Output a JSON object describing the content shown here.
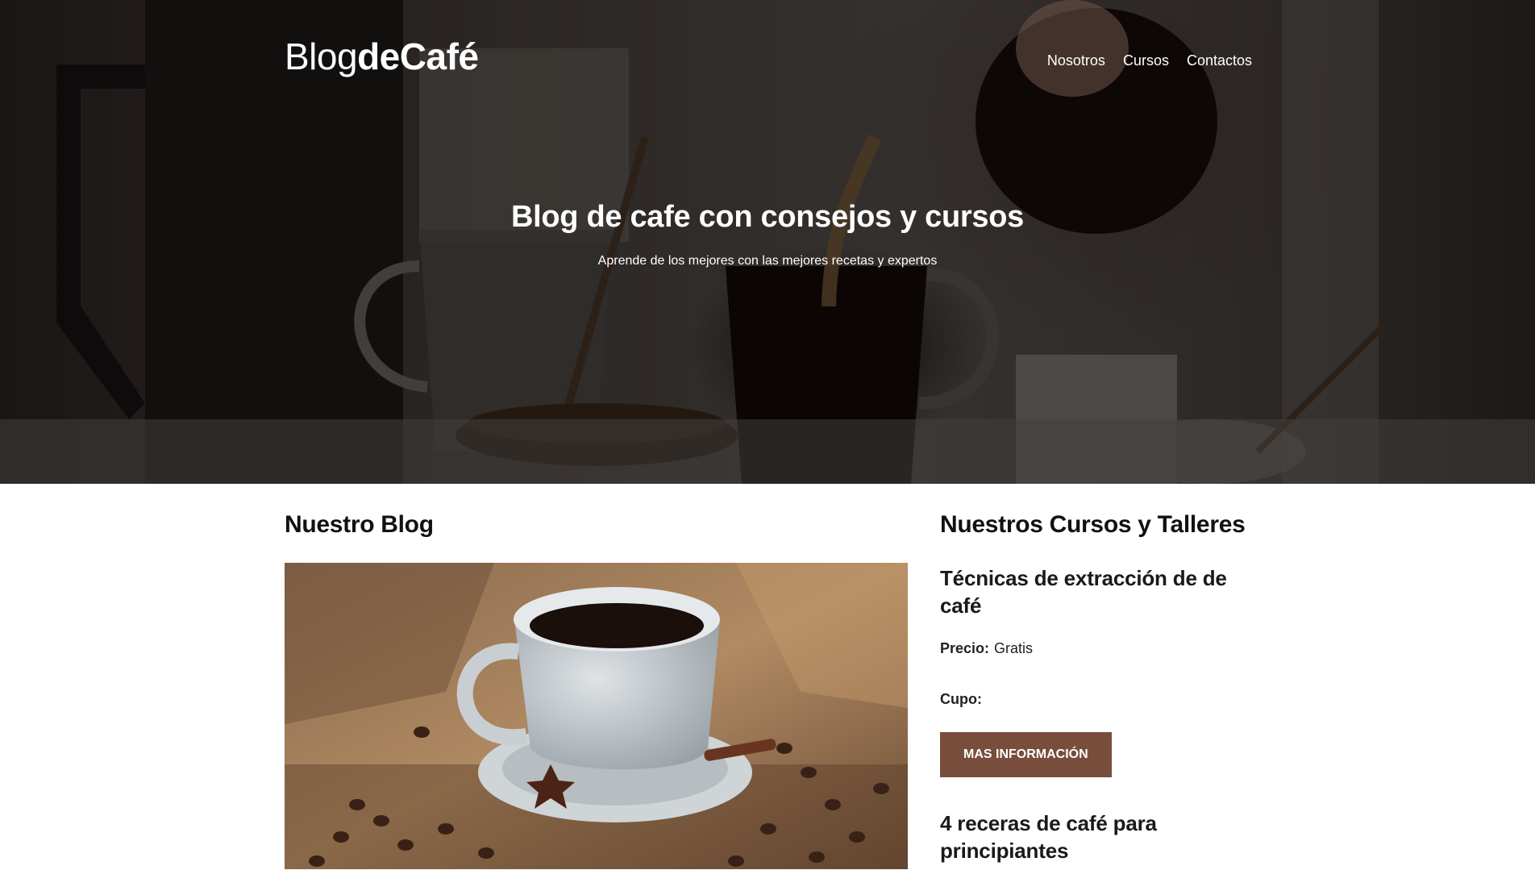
{
  "header": {
    "logo_light": "Blog",
    "logo_bold": "deCafé",
    "nav": [
      {
        "label": "Nosotros"
      },
      {
        "label": "Cursos"
      },
      {
        "label": "Contactos"
      }
    ]
  },
  "hero": {
    "title": "Blog de cafe con consejos y cursos",
    "subtitle": "Aprende de los mejores con las mejores recetas y expertos"
  },
  "blog": {
    "heading": "Nuestro Blog"
  },
  "courses": {
    "heading": "Nuestros Cursos y Talleres",
    "items": [
      {
        "title": "Técnicas de extracción de de café",
        "price_label": "Precio:",
        "price_value": "Gratis",
        "quota_label": "Cupo:",
        "quota_value": "",
        "button_label": "MAS INFORMACIÓN"
      },
      {
        "title": "4 receras de café para principiantes"
      }
    ]
  },
  "colors": {
    "accent": "#784d3c",
    "text": "#1a1a1a",
    "background": "#ffffff"
  }
}
